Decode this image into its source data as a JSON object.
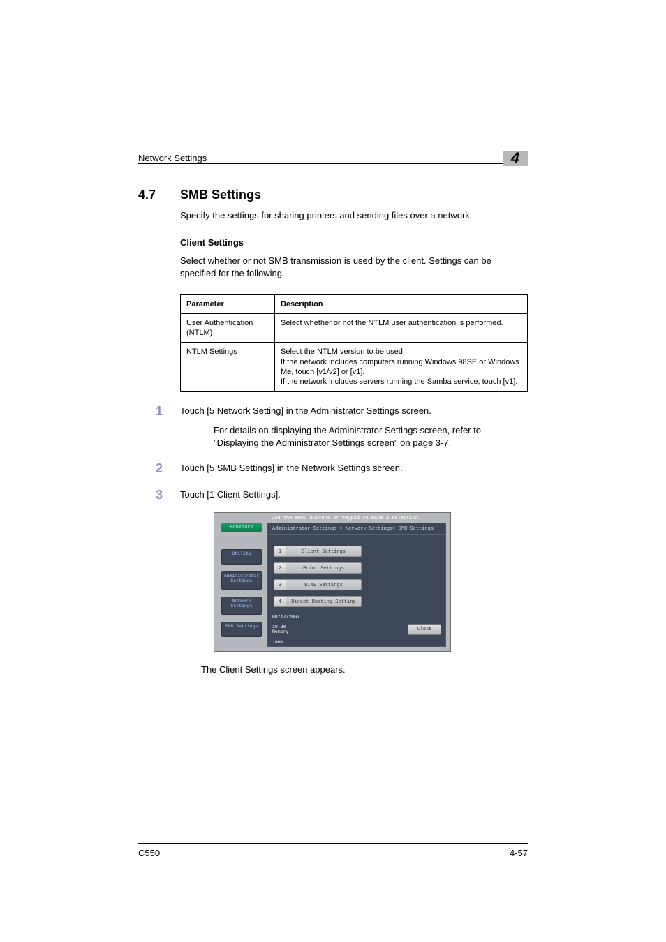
{
  "header": {
    "title": "Network Settings",
    "chapter": "4"
  },
  "section": {
    "number": "4.7",
    "title": "SMB Settings",
    "intro": "Specify the settings for sharing printers and sending files over a network."
  },
  "subsection": {
    "title": "Client Settings",
    "intro": "Select whether or not SMB transmission is used by the client. Settings can be specified for the following."
  },
  "table": {
    "head": {
      "param": "Parameter",
      "desc": "Description"
    },
    "rows": [
      {
        "param": "User Authentication (NTLM)",
        "desc": "Select whether or not the NTLM user authentication is performed."
      },
      {
        "param": "NTLM Settings",
        "desc": "Select the NTLM version to be used.\nIf the network includes computers running Windows 98SE or Windows Me, touch [v1/v2] or [v1].\nIf the network includes servers running the Samba service, touch [v1]."
      }
    ]
  },
  "steps": {
    "s1": {
      "text": "Touch [5 Network Setting] in the Administrator Settings screen.",
      "sub": "For details on displaying the Administrator Settings screen, refer to \"Displaying the Administrator Settings screen\" on page 3-7."
    },
    "s2": {
      "text": "Touch [5 SMB Settings] in the Network Settings screen."
    },
    "s3": {
      "text": "Touch [1 Client Settings]."
    },
    "after": "The Client Settings screen appears."
  },
  "panel": {
    "instr": "Use the menu buttons or keypad to make a selection.",
    "bookmark": "Bookmark",
    "breadcrumb": "Administrator Settings > Network Settings> SMB Settings",
    "side": {
      "utility": "Utility",
      "admin": "Administrator Settings",
      "network": "Network Settings",
      "smb": "SMB Settings"
    },
    "menus": [
      {
        "n": "1",
        "label": "Client Settings"
      },
      {
        "n": "2",
        "label": "Print Settings"
      },
      {
        "n": "3",
        "label": "WINS Settings"
      },
      {
        "n": "4",
        "label": "Direct Hosting Setting"
      }
    ],
    "status": {
      "date": "08/17/2007",
      "time": "10:30",
      "memLabel": "Memory",
      "memVal": "100%"
    },
    "close": "Close"
  },
  "footer": {
    "model": "C550",
    "page": "4-57"
  }
}
